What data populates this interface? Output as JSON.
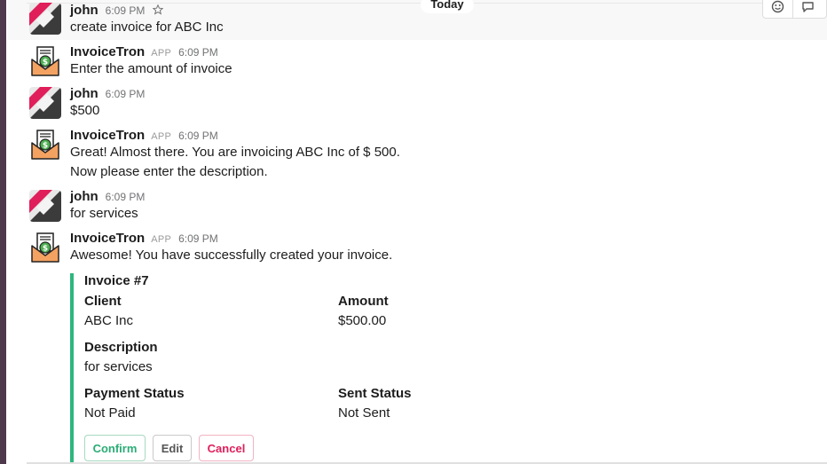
{
  "divider": {
    "label": "Today"
  },
  "messages": [
    {
      "sender": "john",
      "tag": "",
      "time": "6:09 PM",
      "lines": [
        "create invoice for ABC Inc"
      ]
    },
    {
      "sender": "InvoiceTron",
      "tag": "APP",
      "time": "6:09 PM",
      "lines": [
        "Enter the amount of invoice"
      ]
    },
    {
      "sender": "john",
      "tag": "",
      "time": "6:09 PM",
      "lines": [
        "$500"
      ]
    },
    {
      "sender": "InvoiceTron",
      "tag": "APP",
      "time": "6:09 PM",
      "lines": [
        "Great! Almost there. You are invoicing ABC Inc of $ 500.",
        "Now please enter the description."
      ]
    },
    {
      "sender": "john",
      "tag": "",
      "time": "6:09 PM",
      "lines": [
        "for services"
      ]
    },
    {
      "sender": "InvoiceTron",
      "tag": "APP",
      "time": "6:09 PM",
      "lines": [
        "Awesome! You have successfully created your invoice."
      ]
    }
  ],
  "invoice": {
    "title": "Invoice #7",
    "fields": {
      "client_label": "Client",
      "client_value": "ABC Inc",
      "amount_label": "Amount",
      "amount_value": "$500.00",
      "description_label": "Description",
      "description_value": "for services",
      "payment_label": "Payment Status",
      "payment_value": "Not Paid",
      "sent_label": "Sent Status",
      "sent_value": "Not Sent"
    },
    "buttons": {
      "confirm": "Confirm",
      "edit": "Edit",
      "cancel": "Cancel"
    },
    "accent_color": "#2eb67d"
  },
  "icons": {
    "john_avatar": "user-avatar-icon",
    "bot_avatar": "invoice-envelope-icon",
    "star": "star-icon",
    "reaction": "add-reaction-icon",
    "thread": "reply-thread-icon"
  }
}
